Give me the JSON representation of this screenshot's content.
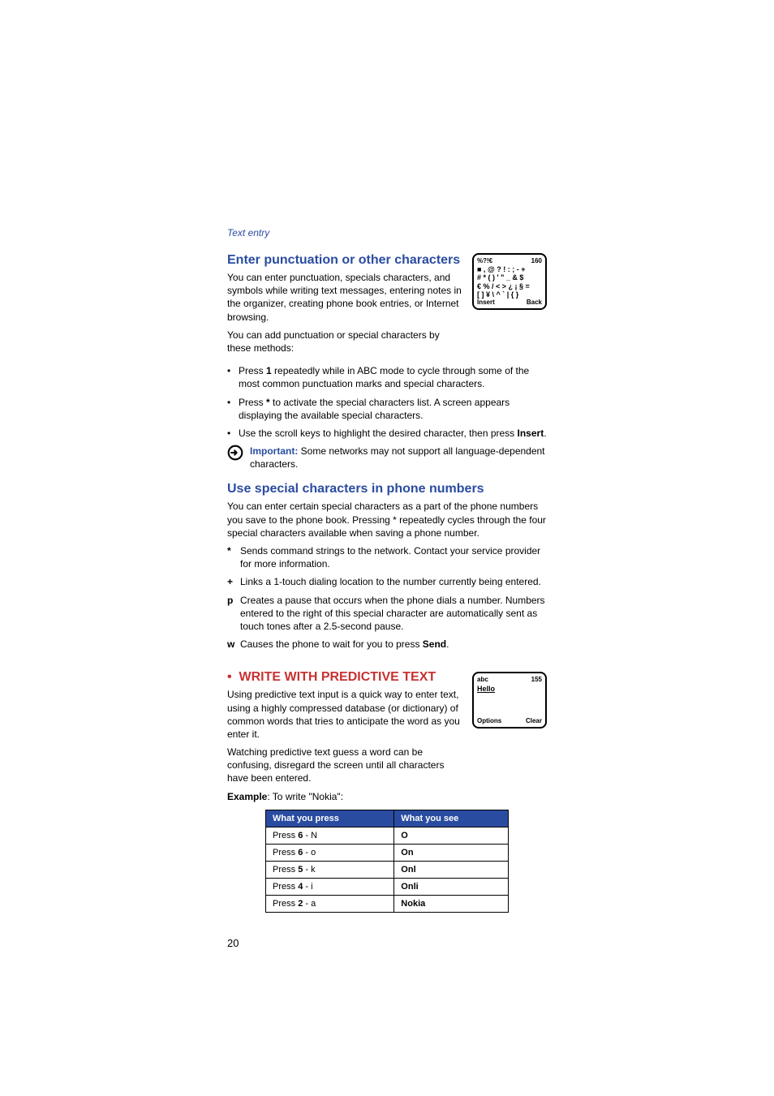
{
  "breadcrumb": "Text entry",
  "section1": {
    "title": "Enter punctuation or other characters",
    "p1": "You can enter punctuation, specials characters, and symbols while writing text messages, entering notes in the organizer, creating phone book entries, or Internet browsing.",
    "p2": "You can add punctuation or special characters by these methods:",
    "bullets": [
      {
        "pre": "Press ",
        "key": "1",
        "post": " repeatedly while in ABC mode to cycle through some of the most common punctuation marks and special characters."
      },
      {
        "pre": "Press ",
        "key": "*",
        "post": " to activate the special characters list. A screen appears displaying the available special characters."
      },
      {
        "pre": "Use the scroll keys to highlight the desired character, then press ",
        "key": "Insert",
        "post": "."
      }
    ],
    "important_label": "Important:",
    "important_text": " Some networks may not support all language-dependent characters.",
    "screen": {
      "tl": "%?!€",
      "tr": "160",
      "l1": "■ , @ ? ! : ; - +",
      "l2": "# * ( ) ' \" _ & $",
      "l3": "€ % / < > ¿ ¡ § =",
      "l4": "[ ] ¥ \\ ^ ` | { }",
      "bl": "Insert",
      "br": "Back"
    }
  },
  "section2": {
    "title": "Use special characters in phone numbers",
    "p1": "You can enter certain special characters as a part of the phone numbers you save to the phone book. Pressing * repeatedly cycles through the four special characters available when saving a phone number.",
    "defs": [
      {
        "k": "*",
        "t": "Sends command strings to the network. Contact your service provider for more information."
      },
      {
        "k": "+",
        "t": "Links a 1-touch dialing location to the number currently being entered."
      },
      {
        "k": "p",
        "t": "Creates a pause that occurs when the phone dials a number. Numbers entered to the right of this special character are automatically sent as touch tones after a 2.5-second pause."
      },
      {
        "k": "w",
        "t_pre": "Causes the phone to wait for you to press ",
        "t_bold": "Send",
        "t_post": "."
      }
    ]
  },
  "section3": {
    "bullet": "•",
    "title": "WRITE WITH PREDICTIVE TEXT",
    "p1": "Using predictive text input is a quick way to enter text, using a highly compressed database (or dictionary) of common words that tries to anticipate the word as you enter it.",
    "p2": "Watching predictive text guess a word can be confusing, disregard the screen until all characters have been entered.",
    "example_label": "Example",
    "example_text": ": To write \"Nokia\":",
    "screen": {
      "tl": "abc",
      "tr": "155",
      "word": "Hello",
      "bl": "Options",
      "br": "Clear"
    },
    "table": {
      "h1": "What you press",
      "h2": "What you see",
      "rows": [
        {
          "press_pre": "Press ",
          "press_key": "6",
          "press_post": " - N",
          "see": "O"
        },
        {
          "press_pre": "Press ",
          "press_key": "6",
          "press_post": " - o",
          "see": "On"
        },
        {
          "press_pre": "Press ",
          "press_key": "5",
          "press_post": " - k",
          "see": "Onl"
        },
        {
          "press_pre": "Press ",
          "press_key": "4",
          "press_post": " - i",
          "see": "Onli"
        },
        {
          "press_pre": "Press ",
          "press_key": "2",
          "press_post": " - a",
          "see": "Nokia"
        }
      ]
    }
  },
  "page_number": "20"
}
